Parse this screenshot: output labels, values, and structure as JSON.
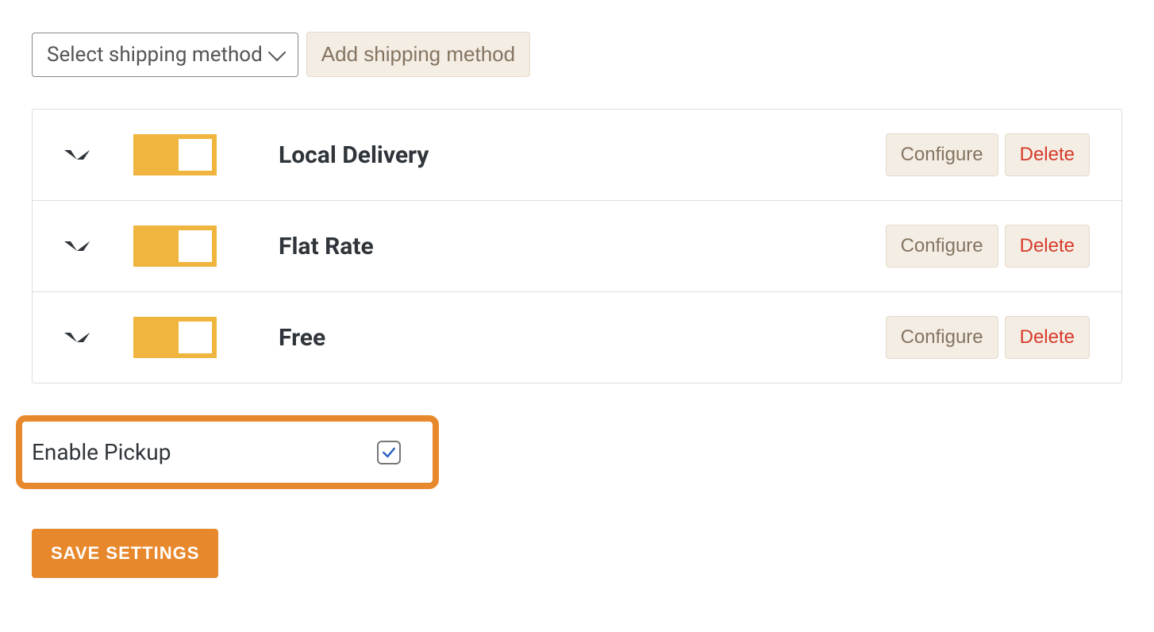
{
  "topbar": {
    "select_placeholder": "Select shipping method",
    "add_label": "Add shipping method"
  },
  "methods": [
    {
      "name": "Local Delivery",
      "configure_label": "Configure",
      "delete_label": "Delete"
    },
    {
      "name": "Flat Rate",
      "configure_label": "Configure",
      "delete_label": "Delete"
    },
    {
      "name": "Free",
      "configure_label": "Configure",
      "delete_label": "Delete"
    }
  ],
  "pickup": {
    "label": "Enable Pickup",
    "checked": true
  },
  "save_label": "SAVE SETTINGS"
}
